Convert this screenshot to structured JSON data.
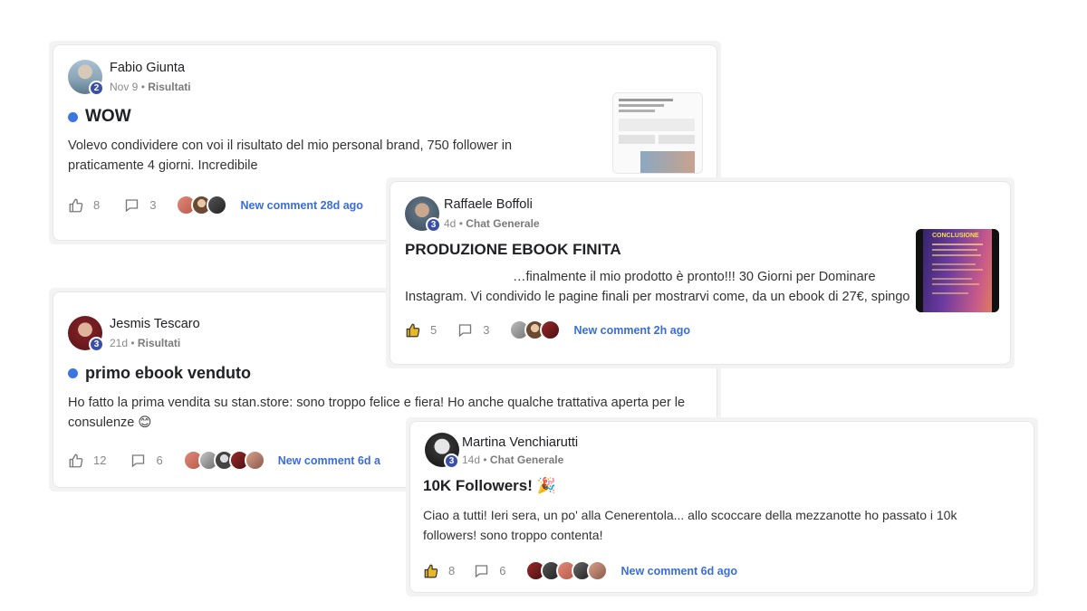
{
  "posts": [
    {
      "author": "Fabio Giunta",
      "level": "2",
      "date": "Nov 9",
      "category": "Risultati",
      "title": "WOW",
      "body": "Volevo condividere con voi il risultato del mio personal brand, 750 follower in praticamente 4 giorni. Incredibile",
      "likes": "8",
      "comments": "3",
      "new_comment": "New comment 28d ago"
    },
    {
      "author": "Raffaele Boffoli",
      "level": "3",
      "date": "4d",
      "category": "Chat Generale",
      "title": "PRODUZIONE EBOOK FINITA",
      "body_line1": "…finalmente il mio prodotto è pronto!!! 30 Giorni per Dominare",
      "body_line2": "Instagram. Vi condivido le pagine finali per mostrarvi come, da un ebook di 27€, spingo",
      "likes": "5",
      "comments": "3",
      "new_comment": "New comment 2h ago",
      "thumbnail_heading": "CONCLUSIONE"
    },
    {
      "author": "Jesmis Tescaro",
      "level": "3",
      "date": "21d",
      "category": "Risultati",
      "title": "primo ebook venduto",
      "body": "Ho fatto la prima vendita su stan.store: sono troppo felice e fiera! Ho anche qualche trattativa aperta per le consulenze 😊",
      "likes": "12",
      "comments": "6",
      "new_comment": "New comment 6d a"
    },
    {
      "author": "Martina Venchiarutti",
      "level": "3",
      "date": "14d",
      "category": "Chat Generale",
      "title": "10K Followers! 🎉",
      "body": "Ciao a tutti! Ieri sera, un po' alla Cenerentola... allo scoccare della mezzanotte ho passato i 10k followers! sono troppo contenta!",
      "likes": "8",
      "comments": "6",
      "new_comment": "New comment 6d ago"
    }
  ],
  "colors": {
    "accent_blue": "#3a6ddc",
    "unread_dot": "#3a75e0",
    "level_badge": "#3b4fa8",
    "like_active": "#e8b923"
  },
  "icons": {
    "like": "thumbs-up-icon",
    "comment": "speech-bubble-icon"
  }
}
